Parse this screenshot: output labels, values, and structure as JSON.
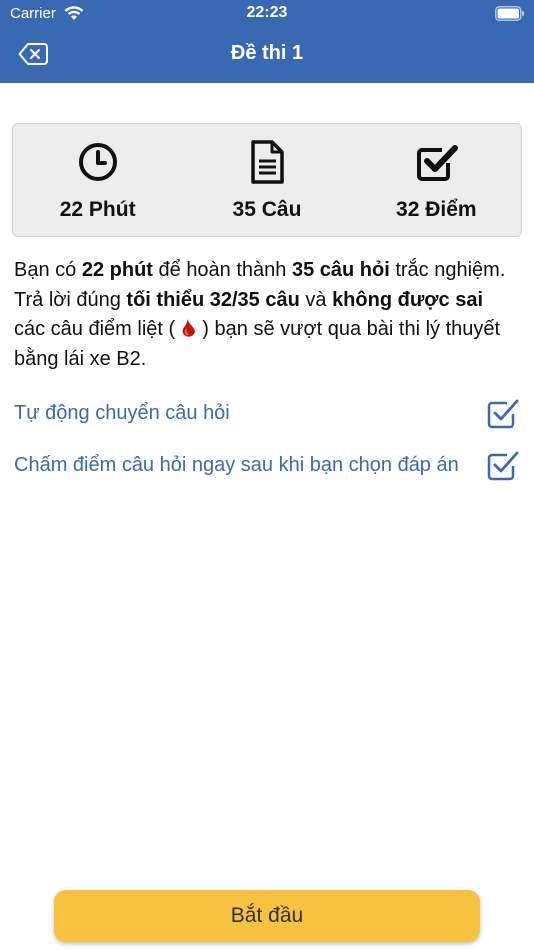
{
  "status_bar": {
    "carrier": "Carrier",
    "time": "22:23"
  },
  "nav": {
    "title": "Đề thi 1",
    "back_icon": "backspace-icon"
  },
  "summary": {
    "time_label": "22 Phút",
    "questions_label": "35 Câu",
    "score_label": "32 Điểm"
  },
  "description": {
    "p1": "Bạn có ",
    "b1": "22 phút",
    "p2": " để hoàn thành ",
    "b2": "35 câu hỏi",
    "p3": " trắc nghiệm. Trả lời đúng ",
    "b3": "tối thiểu 32/35 câu",
    "p4": " và ",
    "b4": "không được sai",
    "p5": " các câu điểm liệt (",
    "p6": ") bạn sẽ vượt qua bài thi lý thuyết bằng lái xe B2."
  },
  "options": [
    {
      "label": "Tự động chuyển câu hỏi",
      "checked": true
    },
    {
      "label": "Chấm điểm câu hỏi ngay sau khi bạn chọn đáp án",
      "checked": true
    }
  ],
  "start_button": {
    "label": "Bắt đầu"
  },
  "colors": {
    "header": "#3a69b3",
    "accent": "#3a69b3",
    "button": "#f6c23f",
    "drop": "#c0140c"
  }
}
